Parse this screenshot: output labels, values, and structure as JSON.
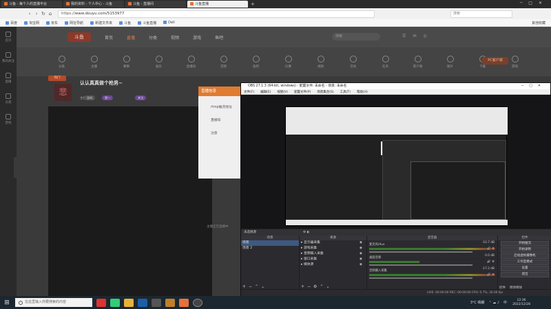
{
  "browser": {
    "tabs": [
      {
        "label": "斗鱼 - 每个人的直播平台",
        "active": false,
        "color": "#e8713a"
      },
      {
        "label": "我的资料 - 个人中心 - 斗鱼",
        "active": false,
        "color": "#e8713a"
      },
      {
        "label": "斗鱼 - 直播间",
        "active": false,
        "color": "#e8713a"
      },
      {
        "label": "斗鱼直播",
        "active": true,
        "color": "#e8713a"
      }
    ],
    "url_secure": "https://",
    "url": "www.douyu.com/5153977",
    "search_placeholder": "搜索",
    "bookmarks": [
      "百度",
      "淘宝网",
      "京东",
      "网址导航",
      "新建文件夹",
      "斗鱼",
      "斗鱼直播",
      "Dell"
    ],
    "bookmarks_right": "其他收藏"
  },
  "sidebar": {
    "items": [
      "首页",
      "我的关注",
      "直播",
      "分类",
      "游戏"
    ]
  },
  "site": {
    "logo": "斗鱼",
    "nav": [
      {
        "label": "首页",
        "active": false
      },
      {
        "label": "直播",
        "active": true
      },
      {
        "label": "分类",
        "active": false
      },
      {
        "label": "视频",
        "active": false
      },
      {
        "label": "游戏",
        "active": false
      },
      {
        "label": "鱼吧",
        "active": false
      }
    ],
    "search_placeholder": "搜索",
    "icons": [
      "分类",
      "主播",
      "赛事",
      "娱乐",
      "直播间",
      "音频",
      "鱼吧",
      "比赛",
      "视频",
      "活动",
      "任务",
      "客户端",
      "图片",
      "下载",
      "游戏"
    ],
    "pc_button": "PC客户端",
    "hot_badge": "热门",
    "avatar_glyph": "悲",
    "room_title": "认认真真做个枪男~",
    "room_meta": "主播",
    "tags": [
      "游戏",
      "第一",
      "关注"
    ],
    "popup_title": "直播信息",
    "popup_lines": [
      "rtmp推流地址",
      "直播码",
      "注意"
    ],
    "footer_note": "主播正在直播中"
  },
  "obs": {
    "title": "OBS 27.1.3 (64-bit, windows) - 配置文件: 未命名 - 场景: 未命名",
    "menu": [
      "文件(F)",
      "编辑(E)",
      "视图(V)",
      "配置文件(P)",
      "场景集合(S)",
      "工具(T)",
      "帮助(H)"
    ],
    "source_bar": "未选择源",
    "docks": {
      "scenes_title": "场景",
      "scenes": [
        "场景",
        "场景 2"
      ],
      "sources_title": "来源",
      "sources": [
        "显示器采集",
        "游戏采集",
        "音频输入采集",
        "窗口采集",
        "媒体源"
      ],
      "mixer_title": "混音器",
      "mixer": [
        {
          "name": "麦克风/Aux",
          "db": "-10.7 dB"
        },
        {
          "name": "桌面音频",
          "db": "0.0 dB"
        },
        {
          "name": "音频输入采集",
          "db": "-17.2 dB"
        }
      ],
      "controls_title": "控件",
      "controls": [
        "开始推流",
        "开始录制",
        "启动虚拟摄像机",
        "工作室模式",
        "设置",
        "退出"
      ],
      "controls_tabs": [
        "控件",
        "转场特效"
      ]
    },
    "status": "LIVE: 00:00:00   REC: 00:00:00   CPU: 0.7%, 30.00 fps"
  },
  "taskbar": {
    "search_placeholder": "在这里输入你要搜索的内容",
    "weather": "3°C 晴朗",
    "ime": "中",
    "time": "12:36",
    "date": "2022/12/28"
  }
}
